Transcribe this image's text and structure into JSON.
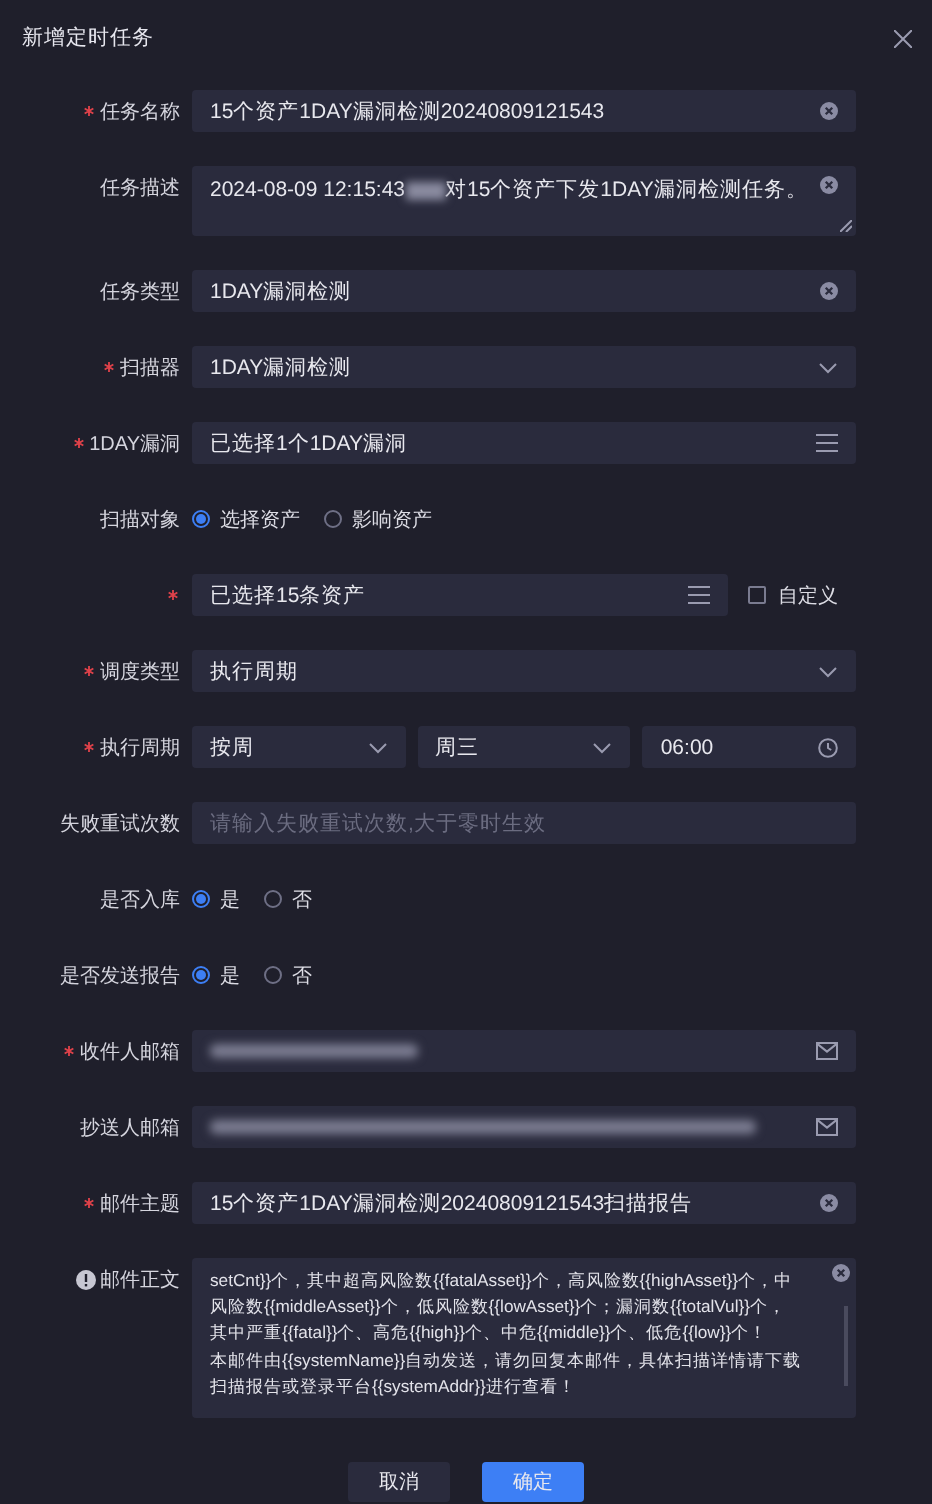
{
  "dialog": {
    "title": "新增定时任务"
  },
  "fields": [
    {
      "kind": "text",
      "label": "任务名称",
      "required": true,
      "value": "15个资产1DAY漏洞检测20240809121543"
    },
    {
      "kind": "textarea",
      "label": "任务描述",
      "required": false,
      "parts": [
        {
          "kind": "text",
          "text": "2024-08-09 12:15:43 "
        },
        {
          "kind": "redacted"
        },
        {
          "kind": "text",
          "text": "对15个资产下发1DAY漏洞检测任务。"
        }
      ]
    },
    {
      "kind": "text",
      "label": "任务类型",
      "required": false,
      "value": "1DAY漏洞检测"
    },
    {
      "kind": "select",
      "label": "扫描器",
      "required": true,
      "value": "1DAY漏洞检测"
    },
    {
      "kind": "picker",
      "label": "1DAY漏洞",
      "required": true,
      "value": "已选择1个1DAY漏洞"
    },
    {
      "kind": "radio",
      "label": "扫描对象",
      "required": false,
      "options": [
        {
          "label": "选择资产",
          "selected": true
        },
        {
          "label": "影响资产",
          "selected": false
        }
      ]
    },
    {
      "kind": "assets",
      "required": true,
      "value": "已选择15条资产",
      "checkbox": {
        "label": "自定义",
        "checked": false
      }
    },
    {
      "kind": "select",
      "label": "调度类型",
      "required": true,
      "value": "执行周期"
    },
    {
      "kind": "cycle",
      "label": "执行周期",
      "required": true,
      "parts": [
        {
          "kind": "select",
          "value": "按周"
        },
        {
          "kind": "select",
          "value": "周三"
        },
        {
          "kind": "time",
          "value": "06:00"
        }
      ]
    },
    {
      "kind": "text",
      "label": "失败重试次数",
      "required": false,
      "placeholder": "请输入失败重试次数,大于零时生效"
    },
    {
      "kind": "radio",
      "label": "是否入库",
      "required": false,
      "options": [
        {
          "label": "是",
          "selected": true
        },
        {
          "label": "否",
          "selected": false
        }
      ]
    },
    {
      "kind": "radio",
      "label": "是否发送报告",
      "required": false,
      "options": [
        {
          "label": "是",
          "selected": true
        },
        {
          "label": "否",
          "selected": false
        }
      ]
    },
    {
      "kind": "email",
      "label": "收件人邮箱",
      "required": true
    },
    {
      "kind": "email",
      "label": "抄送人邮箱",
      "required": false
    },
    {
      "kind": "text",
      "label": "邮件主题",
      "required": true,
      "value": "15个资产1DAY漏洞检测20240809121543扫描报告"
    },
    {
      "kind": "body",
      "label": "邮件正文",
      "required": false,
      "hint": true,
      "lines": [
        "setCnt}}个，其中超高风险数{{fatalAsset}}个，高风险数{{highAsset}}个，中",
        "风险数{{middleAsset}}个，低风险数{{lowAsset}}个；漏洞数{{totalVul}}个，",
        "其中严重{{fatal}}个、高危{{high}}个、中危{{middle}}个、低危{{low}}个！",
        "本邮件由{{systemName}}自动发送，请勿回复本邮件，具体扫描详情请下载",
        "扫描报告或登录平台{{systemAddr}}进行查看！"
      ]
    }
  ],
  "buttons": [
    {
      "label": "取消",
      "kind": "secondary"
    },
    {
      "label": "确定",
      "kind": "primary"
    }
  ]
}
